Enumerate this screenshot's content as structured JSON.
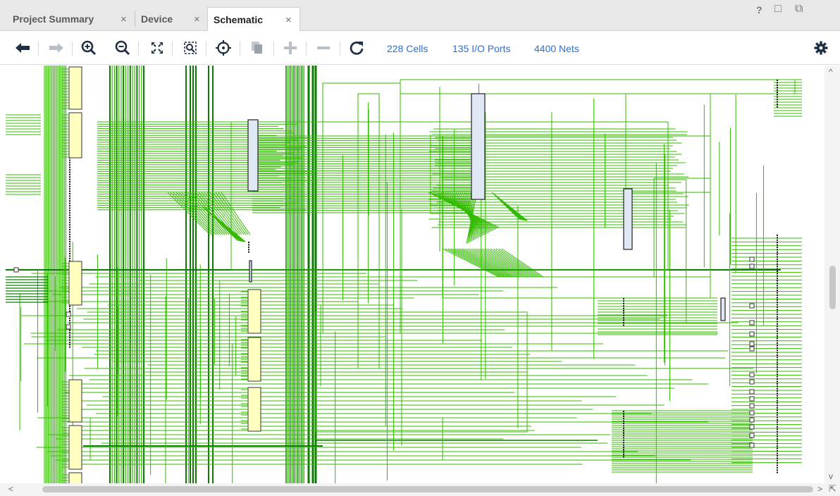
{
  "tabs": [
    {
      "label": "Project Summary",
      "active": false
    },
    {
      "label": "Device",
      "active": false
    },
    {
      "label": "Schematic",
      "active": true
    }
  ],
  "window_controls": {
    "help": "?",
    "restore": "□",
    "float": "⧉"
  },
  "toolbar": {
    "icons": [
      "back-arrow-icon",
      "forward-arrow-icon",
      "zoom-in-icon",
      "zoom-out-icon",
      "fit-view-icon",
      "zoom-selection-icon",
      "center-icon",
      "copy-icon",
      "expand-icon",
      "collapse-icon",
      "refresh-icon"
    ],
    "cells": "228 Cells",
    "io_ports": "135 I/O Ports",
    "nets": "4400 Nets",
    "settings_icon": "gear-icon"
  },
  "colors": {
    "net_green": "#33bb00",
    "net_dark": "#0a7d00",
    "cell_fill": "#ffffc0",
    "big_cell_fill": "#dfe8f4",
    "link_blue": "#2a6fd6"
  },
  "close_glyph": "×"
}
